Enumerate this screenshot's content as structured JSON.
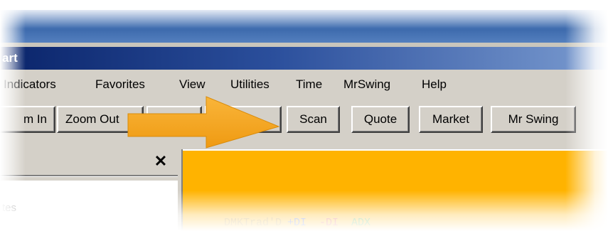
{
  "window": {
    "title_fragment": "art"
  },
  "menu": {
    "items": [
      "Indicators",
      "Favorites",
      "View",
      "Utilities",
      "Time",
      "MrSwing",
      "Help"
    ]
  },
  "toolbar": {
    "zoom_in": "m In",
    "zoom_out": "Zoom Out",
    "scan": "Scan",
    "quote": "Quote",
    "market": "Market",
    "mr_swing": "Mr Swing"
  },
  "panel": {
    "close_glyph": "✕",
    "item_fragment": "tes"
  },
  "chart": {
    "background": "#ffb300",
    "legend": {
      "title": "DMKTrad'D",
      "plus": "+DI",
      "minus": "-DI",
      "adx": "ADX"
    }
  },
  "annotation": {
    "icon": "arrow-right-icon",
    "color": "#f5a623"
  }
}
